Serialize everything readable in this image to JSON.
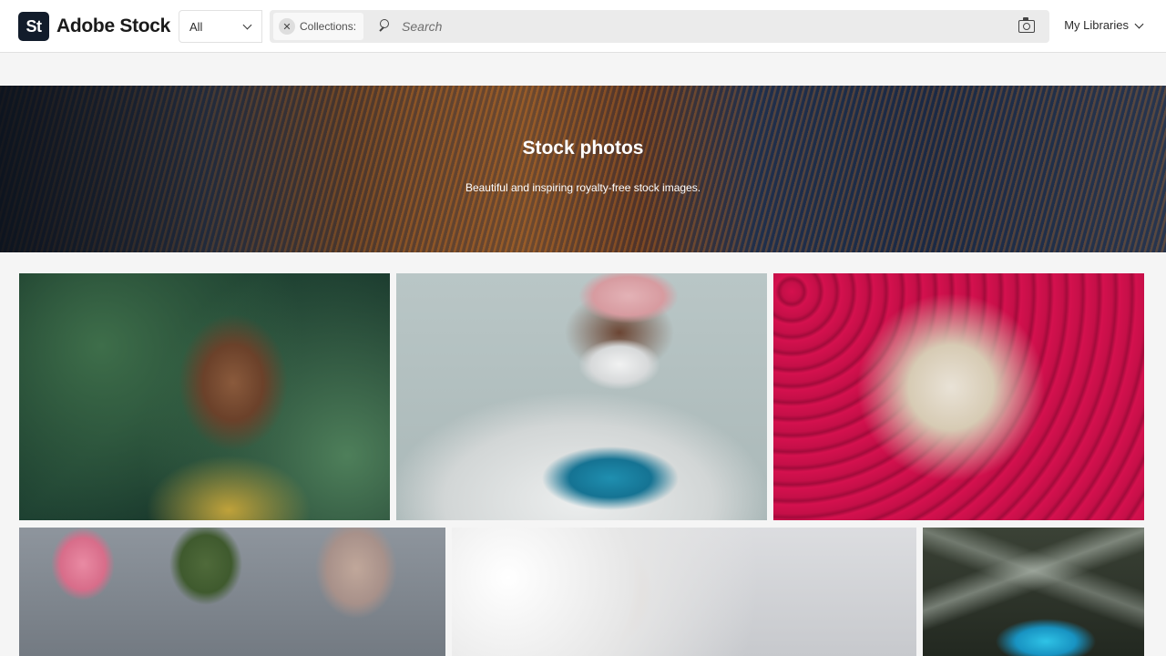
{
  "header": {
    "logo_mark": "St",
    "logo_text": "Adobe Stock",
    "filter_value": "All",
    "collection_chip_label": "Collections:",
    "search_placeholder": "Search",
    "libraries_label": "My Libraries"
  },
  "hero": {
    "title": "Stock photos",
    "subtitle": "Beautiful and inspiring royalty-free stock images."
  },
  "icons": {
    "filter_dropdown": "chevron-down-icon",
    "chip_remove": "close-icon",
    "search": "search-icon",
    "visual_search": "camera-icon",
    "libraries_dropdown": "chevron-down-icon"
  },
  "photos": [
    {
      "subject": "child-among-leaves"
    },
    {
      "subject": "medical-worker-heart-hands"
    },
    {
      "subject": "incense-sticks-red"
    },
    {
      "subject": "women-in-hijabs"
    },
    {
      "subject": "smiling-woman-with-pen"
    },
    {
      "subject": "blue-butterfly-on-leaf"
    }
  ],
  "colors": {
    "logo_bg": "#121c2b",
    "header_bg": "#ffffff",
    "page_bg": "#f5f5f5",
    "search_bg": "#ebebeb"
  }
}
